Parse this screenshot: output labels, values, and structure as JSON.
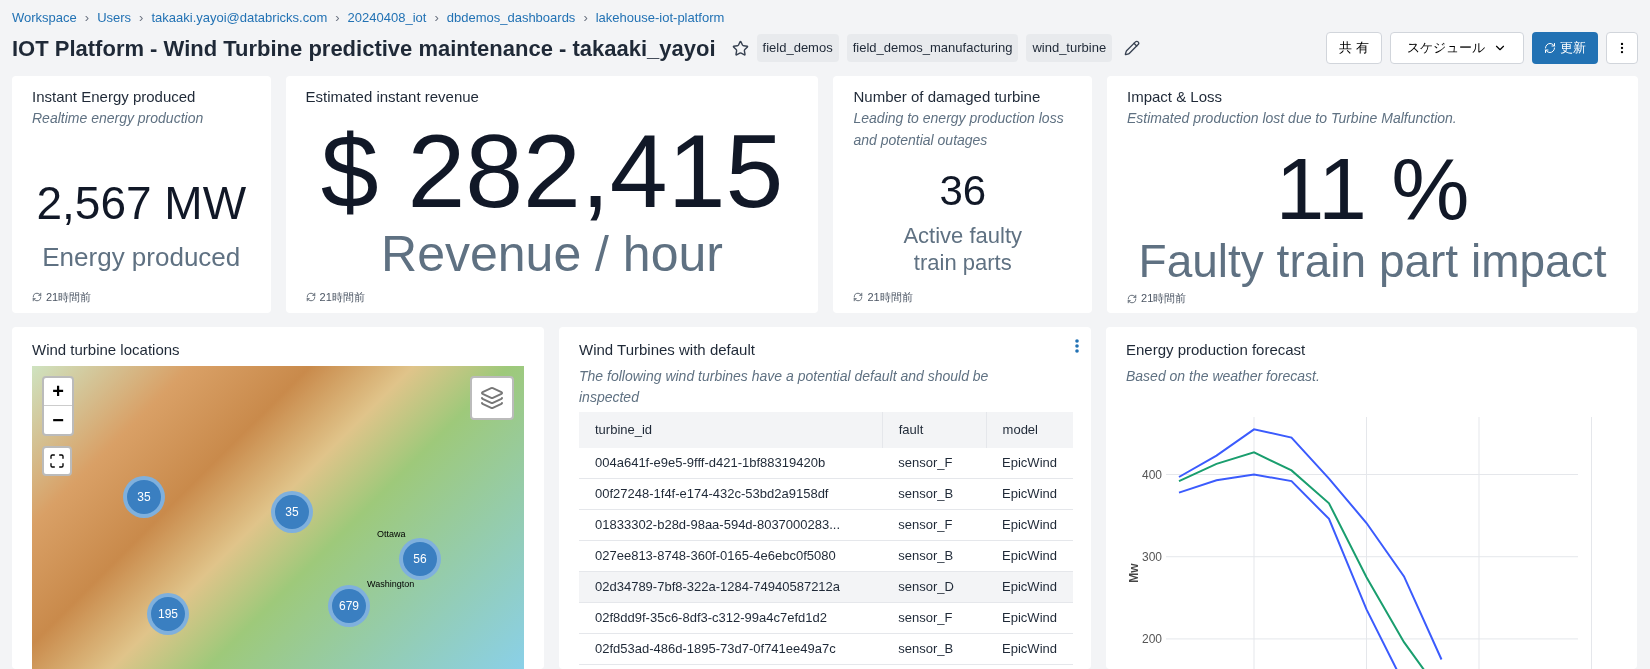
{
  "breadcrumbs": [
    "Workspace",
    "Users",
    "takaaki.yayoi@databricks.com",
    "20240408_iot",
    "dbdemos_dashboards",
    "lakehouse-iot-platform"
  ],
  "breadcrumb_separator": "›",
  "title": "IOT Platform - Wind Turbine predictive maintenance - takaaki_yayoi",
  "favorite": false,
  "tags": [
    "field_demos",
    "field_demos_manufacturing",
    "wind_turbine"
  ],
  "actions": {
    "share": "共 有",
    "schedule": "スケジュール",
    "refresh": "更新"
  },
  "counters": [
    {
      "title": "Instant Energy produced",
      "subtitle": "Realtime energy production",
      "value": "2,567 MW",
      "label": "Energy produced",
      "updated": "21時間前"
    },
    {
      "title": "Estimated instant revenue",
      "value": "$ 282,415",
      "label": "Revenue / hour",
      "updated": "21時間前"
    },
    {
      "title": "Number of damaged turbine",
      "subtitle": "Leading to energy production loss and potential outages",
      "value": "36",
      "label": "Active faulty train parts",
      "updated": "21時間前"
    },
    {
      "title": "Impact & Loss",
      "subtitle": "Estimated production lost due to Turbine Malfunction.",
      "value": "11 %",
      "label": "Faulty train part impact",
      "updated": "21時間前"
    }
  ],
  "map": {
    "title": "Wind turbine locations",
    "zoom_in": "+",
    "zoom_out": "−",
    "clusters": [
      {
        "count": "35"
      },
      {
        "count": "35"
      },
      {
        "count": "56"
      },
      {
        "count": "195"
      },
      {
        "count": "679"
      }
    ],
    "cities": [
      "Ottawa",
      "Washington"
    ]
  },
  "table": {
    "title": "Wind Turbines with default",
    "subtitle": "The following wind turbines have a potential default and should be inspected",
    "columns": [
      "turbine_id",
      "fault",
      "model"
    ],
    "rows": [
      {
        "cells": [
          "004a641f-e9e5-9fff-d421-1bf88319420b",
          "sensor_F",
          "EpicWind"
        ],
        "selected": false
      },
      {
        "cells": [
          "00f27248-1f4f-e174-432c-53bd2a9158df",
          "sensor_B",
          "EpicWind"
        ],
        "selected": false
      },
      {
        "cells": [
          "01833302-b28d-98aa-594d-8037000283...",
          "sensor_F",
          "EpicWind"
        ],
        "selected": false
      },
      {
        "cells": [
          "027ee813-8748-360f-0165-4e6ebc0f5080",
          "sensor_B",
          "EpicWind"
        ],
        "selected": false
      },
      {
        "cells": [
          "02d34789-7bf8-322a-1284-74940587212a",
          "sensor_D",
          "EpicWind"
        ],
        "selected": true
      },
      {
        "cells": [
          "02f8dd9f-35c6-8df3-c312-99a4c7efd1d2",
          "sensor_F",
          "EpicWind"
        ],
        "selected": false
      },
      {
        "cells": [
          "02fd53ad-486d-1895-73d7-0f741ee49a7c",
          "sensor_B",
          "EpicWind"
        ],
        "selected": false
      }
    ]
  },
  "forecast": {
    "title": "Energy production forecast",
    "subtitle": "Based on the weather forecast.",
    "chart_data": {
      "type": "line",
      "ylabel": "Mw",
      "grid": true,
      "ylim": [
        105,
        470
      ],
      "yticks": [
        200,
        300,
        400
      ],
      "series": [
        {
          "color": "#3b5bfd",
          "values": [
            397,
            423,
            455,
            445,
            395,
            341,
            276,
            175,
            null,
            null,
            null
          ]
        },
        {
          "color": "#1a9e6e",
          "values": [
            392,
            413,
            427,
            405,
            365,
            275,
            196,
            133,
            null,
            null,
            null
          ]
        },
        {
          "color": "#3b5bfd",
          "values": [
            378,
            393,
            400,
            392,
            346,
            236,
            145,
            null,
            null,
            null,
            null
          ]
        }
      ]
    }
  }
}
